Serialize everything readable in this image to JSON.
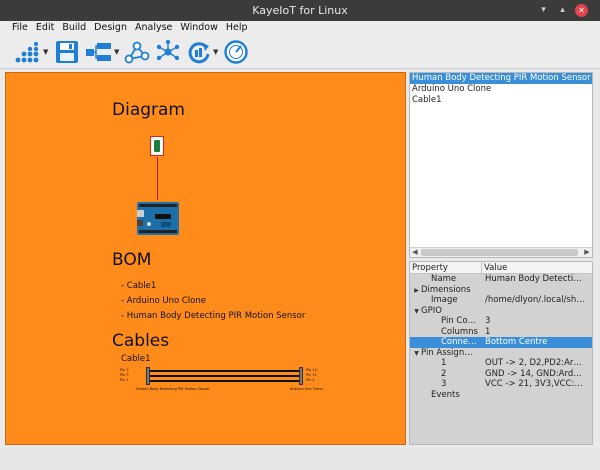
{
  "window": {
    "title": "KayeIoT for Linux"
  },
  "menu": [
    "File",
    "Edit",
    "Build",
    "Design",
    "Analyse",
    "Window",
    "Help"
  ],
  "toolbar": {
    "buttons": [
      {
        "icon": "grid-dots-icon",
        "has_dropdown": true
      },
      {
        "icon": "save-icon",
        "has_dropdown": false
      },
      {
        "icon": "connect-blocks-icon",
        "has_dropdown": true
      },
      {
        "icon": "network-nodes-icon",
        "has_dropdown": false
      },
      {
        "icon": "hub-icon",
        "has_dropdown": false
      },
      {
        "icon": "sync-icon",
        "has_dropdown": true
      },
      {
        "icon": "gauge-icon",
        "has_dropdown": false
      }
    ]
  },
  "canvas": {
    "diagram_title": "Diagram",
    "bom_title": "BOM",
    "bom_items": [
      "- Cable1",
      "- Arduino Uno Clone",
      "- Human Body Detecting PIR Motion Sensor"
    ],
    "cables_title": "Cables",
    "cable_name": "Cable1",
    "cable_left_pins": [
      "Pin 2",
      "Pin 3",
      "Pin 1"
    ],
    "cable_right_pins": [
      "Pin 14",
      "Pin 21",
      "Pin 2"
    ],
    "cable_left_label": "Human Body Detecting PIR Motion Sensor",
    "cable_right_label": "Arduino Uno Clone",
    "colors": {
      "background": "#ff8c1a"
    }
  },
  "components_list": {
    "items": [
      "Human Body Detecting PIR Motion Sensor",
      "Arduino Uno Clone",
      "Cable1"
    ],
    "selected_index": 0
  },
  "properties": {
    "headers": [
      "Property",
      "Value"
    ],
    "rows": [
      {
        "key": "Name",
        "value": "Human Body Detecti…",
        "indent": 1,
        "toggle": ""
      },
      {
        "key": "Dimensions",
        "value": "",
        "indent": 0,
        "toggle": "▶"
      },
      {
        "key": "Image",
        "value": "/home/dlyon/.local/sh…",
        "indent": 1,
        "toggle": ""
      },
      {
        "key": "GPIO",
        "value": "",
        "indent": 0,
        "toggle": "▼"
      },
      {
        "key": "Pin Co…",
        "value": "3",
        "indent": 2,
        "toggle": ""
      },
      {
        "key": "Columns",
        "value": "1",
        "indent": 2,
        "toggle": ""
      },
      {
        "key": "Conne…",
        "value": "Bottom Centre",
        "indent": 2,
        "toggle": "",
        "selected": true
      },
      {
        "key": "Pin Assign…",
        "value": "",
        "indent": 0,
        "toggle": "▼"
      },
      {
        "key": "1",
        "value": "OUT -> 2, D2,PD2:Ar…",
        "indent": 2,
        "toggle": ""
      },
      {
        "key": "2",
        "value": "GND -> 14, GND:Ard…",
        "indent": 2,
        "toggle": ""
      },
      {
        "key": "3",
        "value": "VCC -> 21, 3V3,VCC:…",
        "indent": 2,
        "toggle": ""
      },
      {
        "key": "Events",
        "value": "",
        "indent": 1,
        "toggle": ""
      }
    ]
  }
}
